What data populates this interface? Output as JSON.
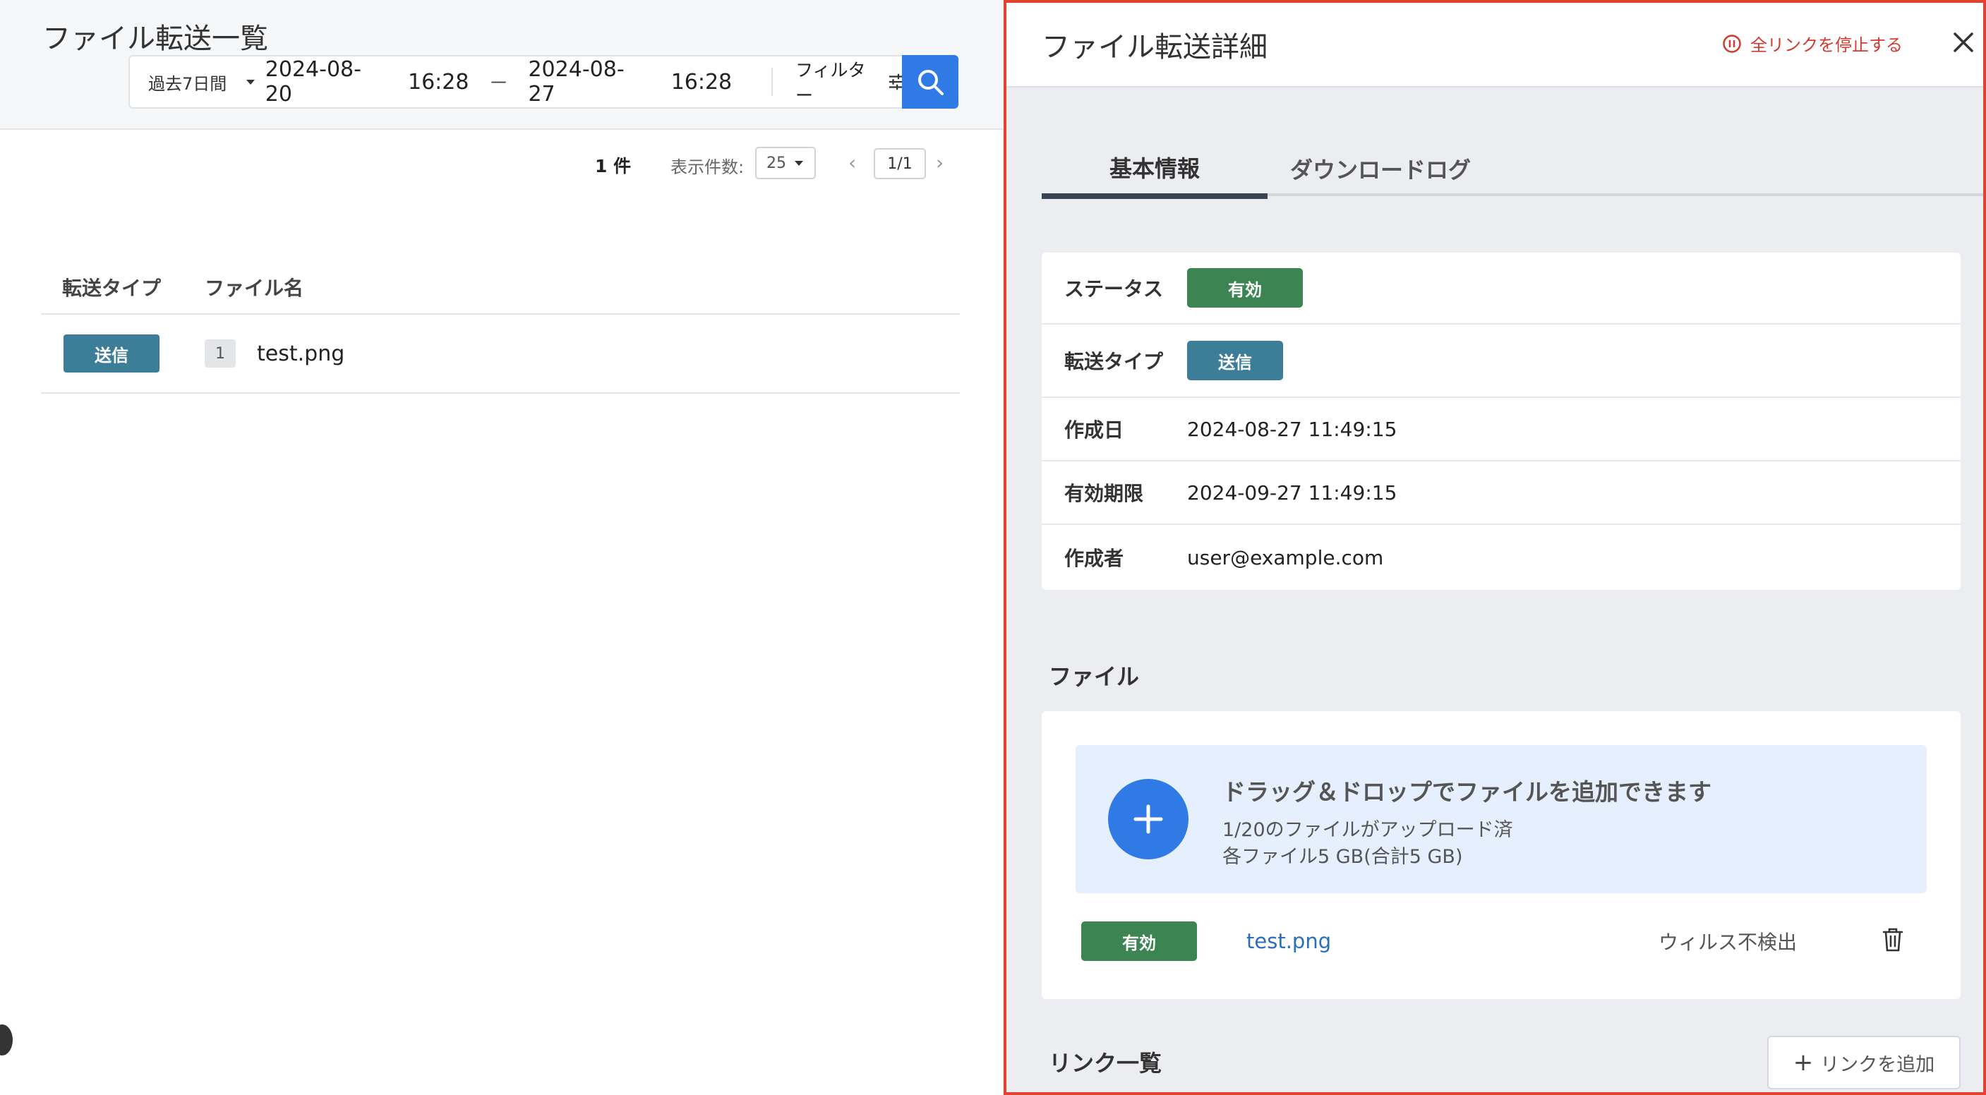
{
  "list": {
    "title": "ファイル転送一覧",
    "filter": {
      "range": "過去7日間",
      "from_date": "2024-08-20",
      "from_time": "16:28",
      "separator": "－",
      "to_date": "2024-08-27",
      "to_time": "16:28",
      "filter_label": "フィルター"
    },
    "pager": {
      "count": "1 件",
      "per_page_label": "表示件数:",
      "per_page_value": "25",
      "page": "1/1",
      "prev": "‹",
      "next": "›"
    },
    "columns": [
      "転送タイプ",
      "ファイル名"
    ],
    "rows": [
      {
        "type": "送信",
        "index": "1",
        "file": "test.png"
      }
    ]
  },
  "detail": {
    "title": "ファイル転送詳細",
    "stop_all": "全リンクを停止する",
    "tabs": [
      "基本情報",
      "ダウンロードログ"
    ],
    "info": {
      "status_label": "ステータス",
      "status_value": "有効",
      "type_label": "転送タイプ",
      "type_value": "送信",
      "created_label": "作成日",
      "created_value": "2024-08-27 11:49:15",
      "expiry_label": "有効期限",
      "expiry_value": "2024-09-27 11:49:15",
      "creator_label": "作成者",
      "creator_value": "user@example.com"
    },
    "files": {
      "section_title": "ファイル",
      "drop_title": "ドラッグ＆ドロップでファイルを追加できます",
      "drop_sub1": "1/20のファイルがアップロード済",
      "drop_sub2": "各ファイル5 GB(合計5 GB)",
      "items": [
        {
          "status": "有効",
          "name": "test.png",
          "scan": "ウィルス不検出"
        }
      ]
    },
    "links": {
      "section_title": "リンク一覧",
      "add_label": "リンクを追加"
    }
  },
  "colors": {
    "primary": "#2f7ae5",
    "valid": "#3c8553",
    "send": "#3c7d98",
    "danger": "#d33a2f",
    "highlight_border": "#e0432f"
  }
}
